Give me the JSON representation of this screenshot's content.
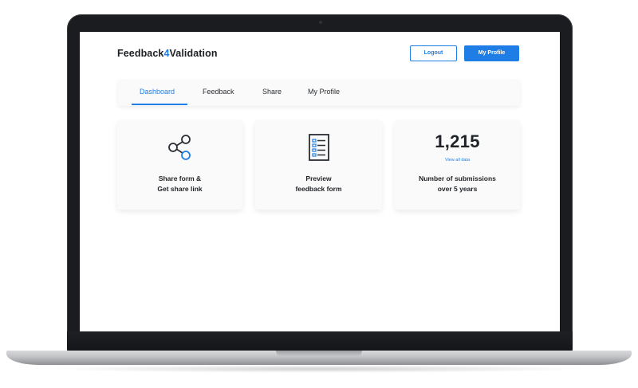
{
  "app": {
    "brand_prefix": "Feedback",
    "brand_accent": "4",
    "brand_suffix": "Validation",
    "accent_color": "#1e7ee5"
  },
  "header": {
    "logout_label": "Logout",
    "profile_label": "My Profile"
  },
  "tabs": [
    {
      "label": "Dashboard",
      "active": true
    },
    {
      "label": "Feedback",
      "active": false
    },
    {
      "label": "Share",
      "active": false
    },
    {
      "label": "My Profile",
      "active": false
    }
  ],
  "cards": {
    "share": {
      "icon": "share-icon",
      "line1": "Share form &",
      "line2": "Get share link"
    },
    "preview": {
      "icon": "form-document-icon",
      "line1": "Preview",
      "line2": "feedback form"
    },
    "stats": {
      "value": "1,215",
      "link": "View all data",
      "line1": "Number of submissions",
      "line2": "over 5 years"
    }
  }
}
